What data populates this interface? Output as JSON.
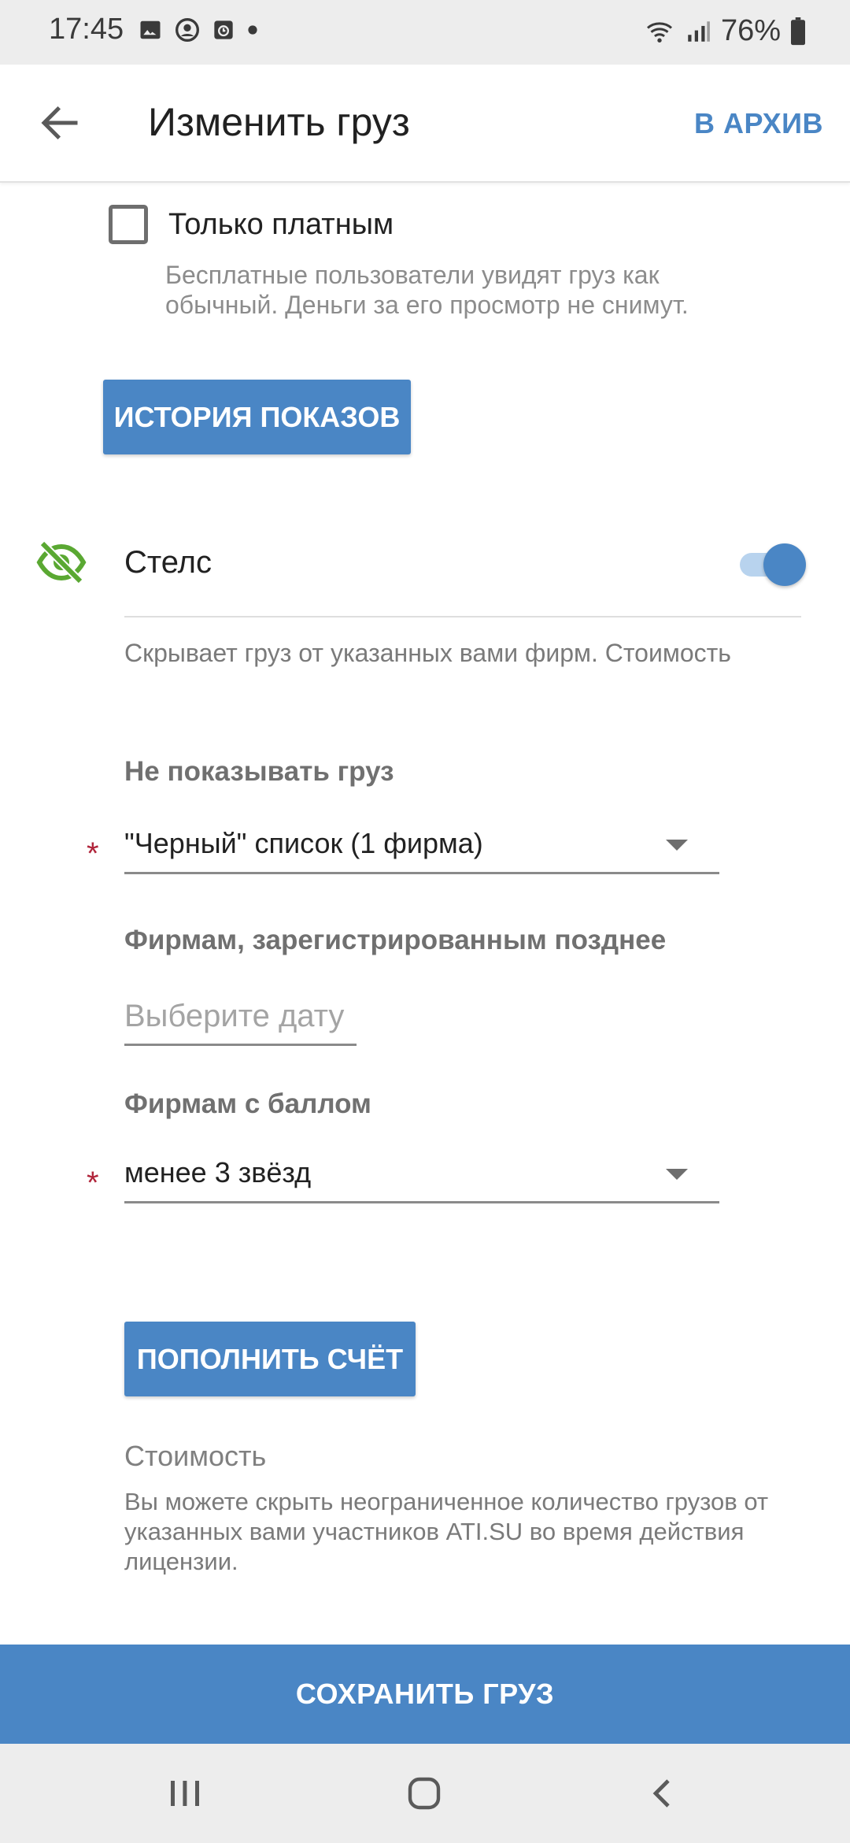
{
  "status_bar": {
    "time": "17:45",
    "battery": "76%",
    "notification_icons": [
      "image-icon",
      "account-circle-icon",
      "clock-app-icon",
      "dot-icon"
    ],
    "right_icons": [
      "wifi-icon",
      "signal-icon",
      "battery-icon"
    ]
  },
  "app_bar": {
    "title": "Изменить груз",
    "archive_label": "В АРХИВ"
  },
  "paid_only": {
    "label": "Только платным",
    "checked": false,
    "hint": "Бесплатные пользователи увидят груз как обычный. Деньги за его просмотр не снимут."
  },
  "history_button": {
    "label": "ИСТОРИЯ ПОКАЗОВ"
  },
  "stealth": {
    "label": "Стелс",
    "enabled": true,
    "description": "Скрывает груз от указанных вами фирм. Стоимость"
  },
  "hide_cargo": {
    "label": "Не показывать груз",
    "required_mark": "*",
    "value": "\"Черный\" список (1 фирма)"
  },
  "registered_later": {
    "label": "Фирмам, зарегистрированным позднее",
    "placeholder": "Выберите дату"
  },
  "rating": {
    "label": "Фирмам с баллом",
    "required_mark": "*",
    "value": "менее 3 звёзд"
  },
  "topup_button": {
    "label": "ПОПОЛНИТЬ СЧЁТ"
  },
  "cost": {
    "title": "Стоимость",
    "description": "Вы можете скрыть неограниченное количество грузов от указанных вами участников ATI.SU во время действия лицензии."
  },
  "save_button": {
    "label": "СОХРАНИТЬ ГРУЗ"
  },
  "colors": {
    "accent": "#4a86c5",
    "stealth_icon": "#5aa832",
    "required": "#b0243a"
  }
}
